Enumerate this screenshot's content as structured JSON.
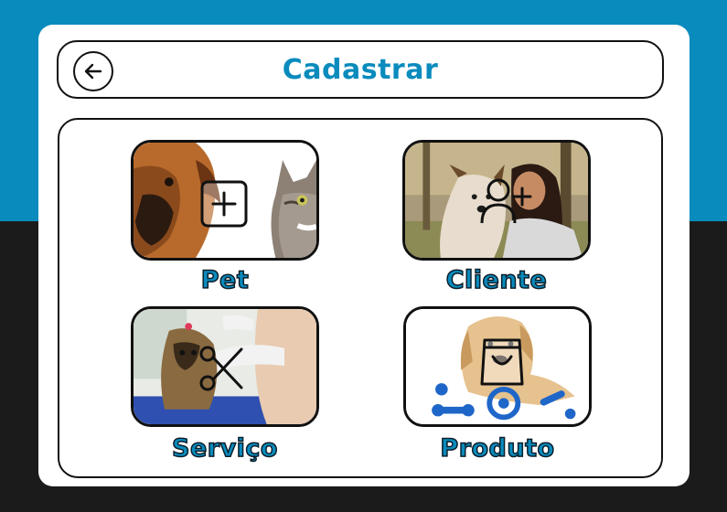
{
  "header": {
    "title": "Cadastrar"
  },
  "icons": {
    "back": "arrow-left-circle-icon",
    "pet": "plus-square-icon",
    "cliente": "user-plus-icon",
    "servico": "scissors-icon",
    "produto": "shopping-bag-icon"
  },
  "options": [
    {
      "label": "Pet"
    },
    {
      "label": "Cliente"
    },
    {
      "label": "Serviço"
    },
    {
      "label": "Produto"
    }
  ],
  "colors": {
    "accent": "#0a8bbd",
    "background_top": "#0a8bbd",
    "background_bottom": "#1b1b1b",
    "card": "#ffffff",
    "outline": "#111111"
  }
}
